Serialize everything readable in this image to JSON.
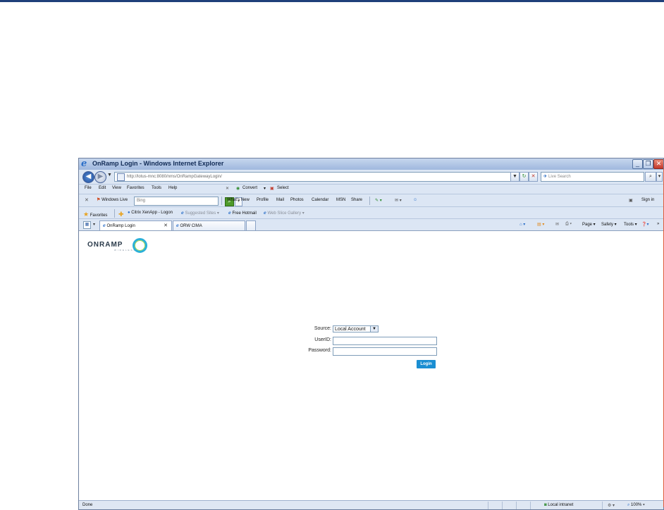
{
  "window": {
    "title": "OnRamp Login - Windows Internet Explorer",
    "minimize": "_",
    "maximize": "❐",
    "close": "✕"
  },
  "address_bar": {
    "url": "http://lotus-mnc:8080/nms/OnRampGatewayLogin/",
    "search_placeholder": "Live Search"
  },
  "menu": [
    "File",
    "Edit",
    "View",
    "Favorites",
    "Tools",
    "Help"
  ],
  "menu_extra": {
    "close": "✕",
    "convert": "Convert",
    "select": "Select"
  },
  "windows_live_bar": {
    "close": "✕",
    "brand": "Windows Live",
    "search_value": "Bing",
    "links": [
      "What's New",
      "Profile",
      "Mail",
      "Photos",
      "Calendar",
      "MSN",
      "Share"
    ],
    "signin": "Sign in"
  },
  "favorites_bar": {
    "favorites": "Favorites",
    "items": [
      "Citrix XenApp - Logon",
      "Suggested Sites",
      "Free Hotmail",
      "Web Slice Gallery"
    ]
  },
  "tabs": {
    "items": [
      "OnRamp Login",
      "ORW CIMA"
    ],
    "commands": [
      "Page",
      "Safety",
      "Tools"
    ]
  },
  "page": {
    "logo_text": "ONRAMP",
    "logo_sub": "WIRELESS",
    "form": {
      "source_label": "Source:",
      "source_value": "Local Account",
      "userid_label": "UserID:",
      "userid_value": "",
      "password_label": "Password:",
      "password_value": "",
      "login_button": "Login"
    }
  },
  "status_bar": {
    "status": "Done",
    "zone": "Local intranet",
    "zoom": "100%"
  }
}
